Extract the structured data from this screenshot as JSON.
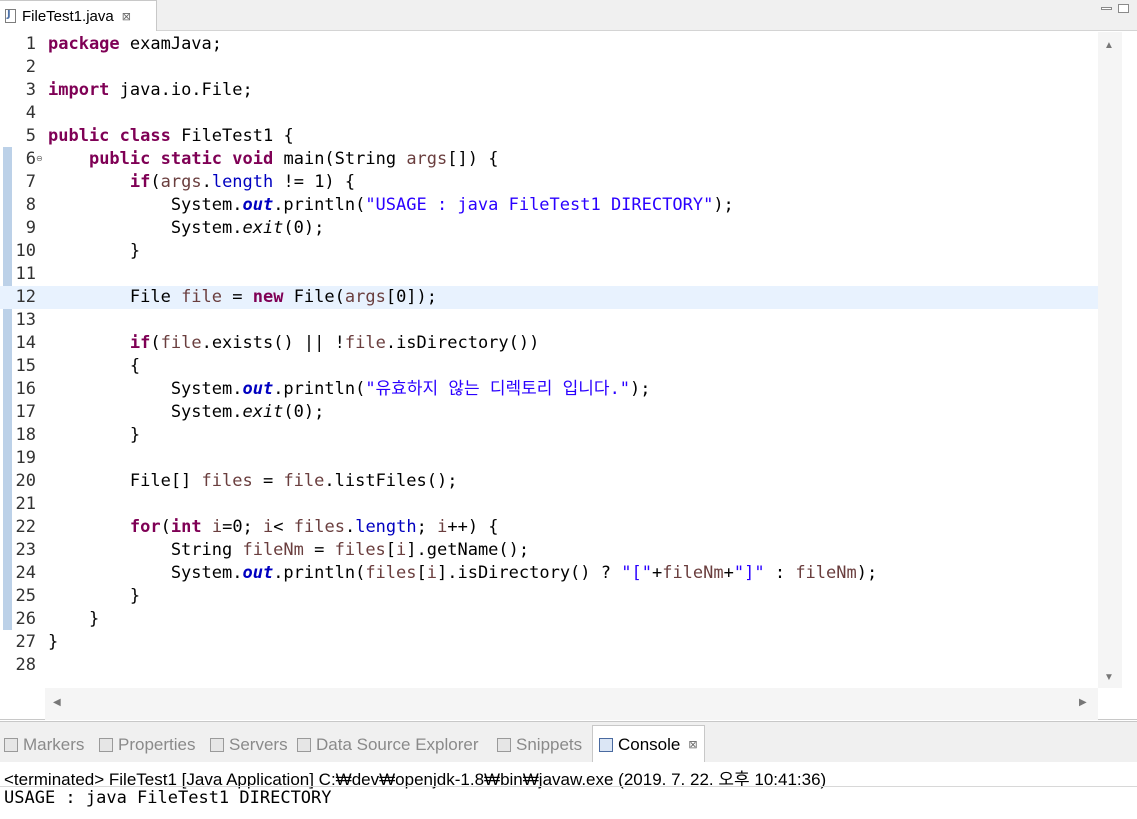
{
  "editor_tab": {
    "title": "FileTest1.java",
    "close_glyph": "⊠"
  },
  "code_lines": [
    {
      "num": "1",
      "code": "package examJava;"
    },
    {
      "num": "2",
      "code": ""
    },
    {
      "num": "3",
      "code": "import java.io.File;"
    },
    {
      "num": "4",
      "code": ""
    },
    {
      "num": "5",
      "code": "public class FileTest1 {"
    },
    {
      "num": "6",
      "code": "    public static void main(String args[]) {"
    },
    {
      "num": "7",
      "code": "        if(args.length != 1) {"
    },
    {
      "num": "8",
      "code": "            System.out.println(\"USAGE : java FileTest1 DIRECTORY\");"
    },
    {
      "num": "9",
      "code": "            System.exit(0);"
    },
    {
      "num": "10",
      "code": "        }"
    },
    {
      "num": "11",
      "code": ""
    },
    {
      "num": "12",
      "code": "        File file = new File(args[0]);"
    },
    {
      "num": "13",
      "code": ""
    },
    {
      "num": "14",
      "code": "        if(file.exists() || !file.isDirectory())"
    },
    {
      "num": "15",
      "code": "        {"
    },
    {
      "num": "16",
      "code": "            System.out.println(\"유효하지 않는 디렉토리 입니다.\");"
    },
    {
      "num": "17",
      "code": "            System.exit(0);"
    },
    {
      "num": "18",
      "code": "        }"
    },
    {
      "num": "19",
      "code": ""
    },
    {
      "num": "20",
      "code": "        File[] files = file.listFiles();"
    },
    {
      "num": "21",
      "code": ""
    },
    {
      "num": "22",
      "code": "        for(int i=0; i< files.length; i++) {"
    },
    {
      "num": "23",
      "code": "            String fileNm = files[i].getName();"
    },
    {
      "num": "24",
      "code": "            System.out.println(files[i].isDirectory() ? \"[\"+fileNm+\"]\" : fileNm);"
    },
    {
      "num": "25",
      "code": "        }"
    },
    {
      "num": "26",
      "code": "    }"
    },
    {
      "num": "27",
      "code": "}"
    },
    {
      "num": "28",
      "code": ""
    }
  ],
  "current_line": 12,
  "fold_line": 6,
  "view_tabs": [
    {
      "label": "Markers",
      "icon": "markers-icon"
    },
    {
      "label": "Properties",
      "icon": "properties-icon"
    },
    {
      "label": "Servers",
      "icon": "servers-icon"
    },
    {
      "label": "Data Source Explorer",
      "icon": "data-source-explorer-icon"
    },
    {
      "label": "Snippets",
      "icon": "snippets-icon"
    },
    {
      "label": "Console",
      "icon": "console-icon",
      "active": true,
      "close_glyph": "⊠"
    }
  ],
  "console": {
    "status": "<terminated> FileTest1 [Java Application] C:₩dev₩openjdk-1.8₩bin₩javaw.exe (2019. 7. 22. 오후 10:41:36)",
    "output": "USAGE : java FileTest1 DIRECTORY"
  },
  "colors": {
    "keyword": "#7f0055",
    "string": "#2a00ff",
    "field": "#0000c0",
    "local_var": "#6a3e3e",
    "current_line_bg": "#e8f2fe",
    "change_ruler": "#bcd1e8"
  }
}
